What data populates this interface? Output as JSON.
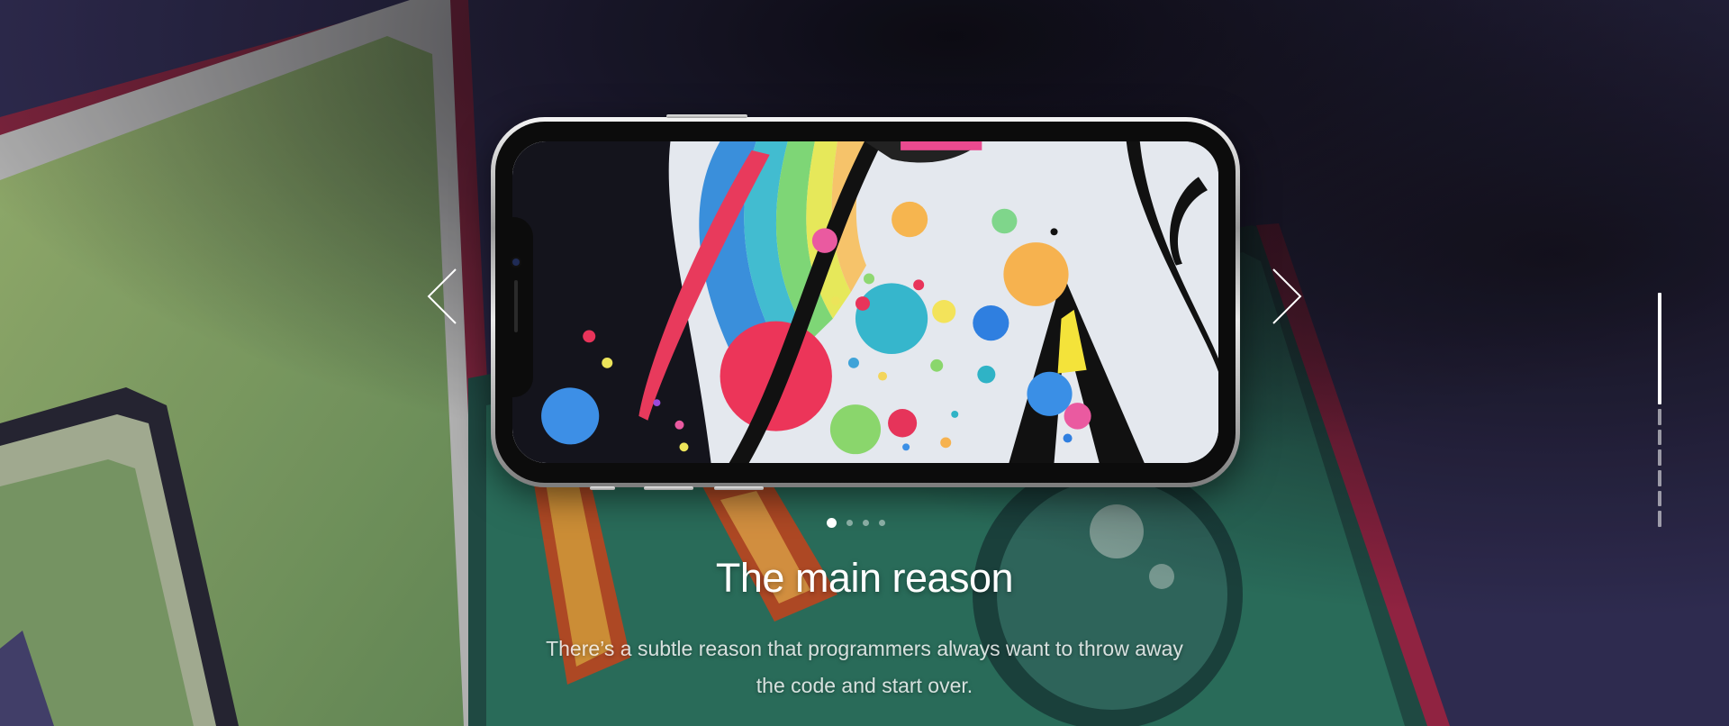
{
  "slide": {
    "title": "The main reason",
    "description": "There’s a subtle reason that programmers always want to throw away the code and start over."
  },
  "controls": {
    "prev_icon": "chevron-left-icon",
    "next_icon": "chevron-right-icon",
    "dots": {
      "count": 4,
      "active": 0
    },
    "vertical_pager": {
      "segments": 7,
      "active": 0
    }
  },
  "colors": {
    "text": "#ffffff",
    "dot_inactive": "rgba(255,255,255,0.45)",
    "wall_base": "#2a2740",
    "wall_green": "#8fae6a",
    "wall_teal": "#2f7a66",
    "wall_red": "#b0284a"
  }
}
